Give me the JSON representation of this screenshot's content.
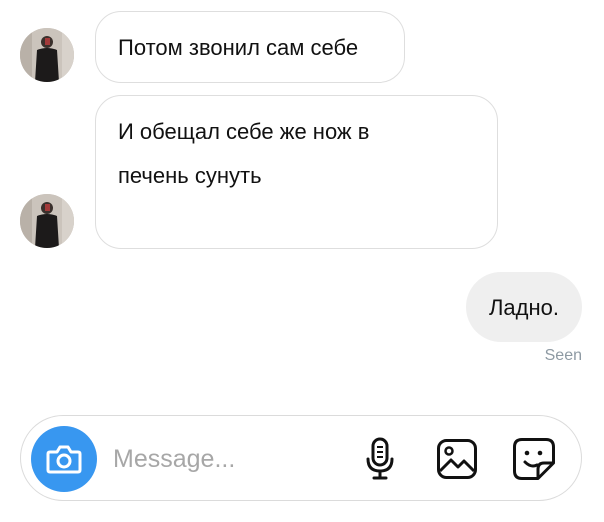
{
  "messages": [
    {
      "sender": "them",
      "text": "Потом звонил сам себе"
    },
    {
      "sender": "them",
      "text_lines": [
        "И обещал себе же нож в",
        "печень сунуть"
      ]
    },
    {
      "sender": "me",
      "text": "Ладно."
    }
  ],
  "status": {
    "seen": "Seen"
  },
  "composer": {
    "placeholder": "Message...",
    "camera_icon": "camera-icon",
    "mic_icon": "microphone-icon",
    "gallery_icon": "gallery-icon",
    "sticker_icon": "sticker-icon"
  },
  "colors": {
    "accent": "#3897f0",
    "outgoing_bubble": "#efefef",
    "incoming_border": "#dedede",
    "seen_text": "#8e9aa3"
  }
}
